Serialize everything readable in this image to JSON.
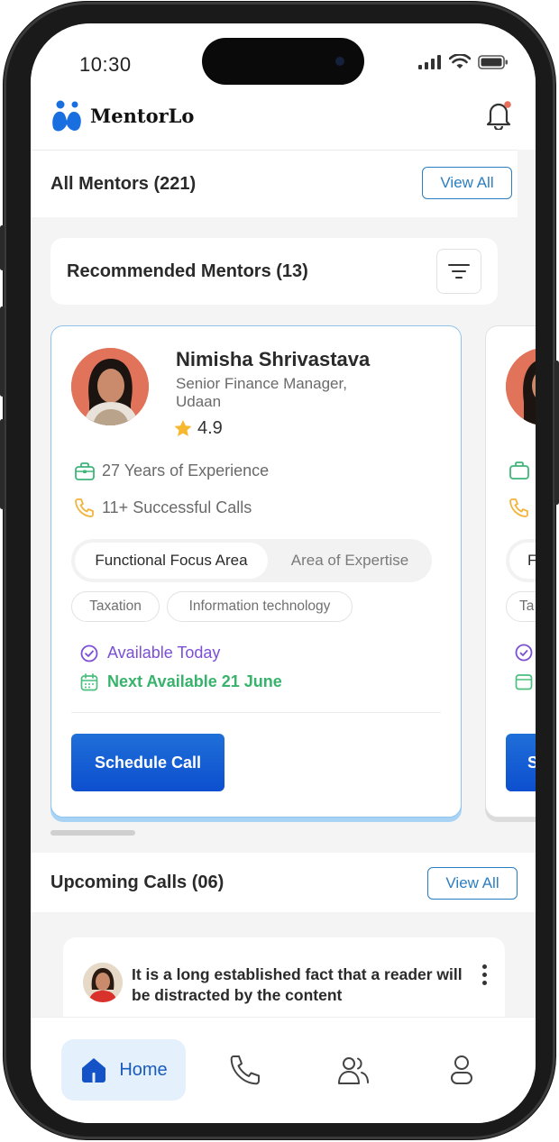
{
  "status_bar": {
    "time": "10:30"
  },
  "app": {
    "brand": "MentorLo"
  },
  "all_mentors": {
    "title": "All Mentors (221)",
    "view_all": "View All"
  },
  "recommended": {
    "title": "Recommended Mentors (13)"
  },
  "mentor_card": {
    "name": "Nimisha Shrivastava",
    "role": "Senior Finance Manager, Udaan",
    "rating": "4.9",
    "experience": "27 Years of Experience",
    "calls": "11+ Successful Calls",
    "tabs": [
      "Functional Focus Area",
      "Area of Expertise"
    ],
    "chips": [
      "Taxation",
      "Information technology"
    ],
    "available": "Available Today",
    "next_available": "Next Available 21 June",
    "schedule_label": "Schedule Call"
  },
  "peek_card": {
    "tab_first_letter": "F",
    "chip_prefix": "Ta",
    "button_prefix": "S"
  },
  "upcoming": {
    "title": "Upcoming Calls (06)",
    "view_all": "View All",
    "item_text": "It is a long established fact that a reader will be distracted by the content"
  },
  "nav": {
    "home_label": "Home",
    "items": [
      "home-icon",
      "phone-icon",
      "users-icon",
      "profile-icon"
    ]
  },
  "colors": {
    "accent": "#0d4fcf",
    "outline": "#2b7ec1",
    "available": "#7b4fd6",
    "next": "#37b36b",
    "rating": "#f5b82e"
  }
}
